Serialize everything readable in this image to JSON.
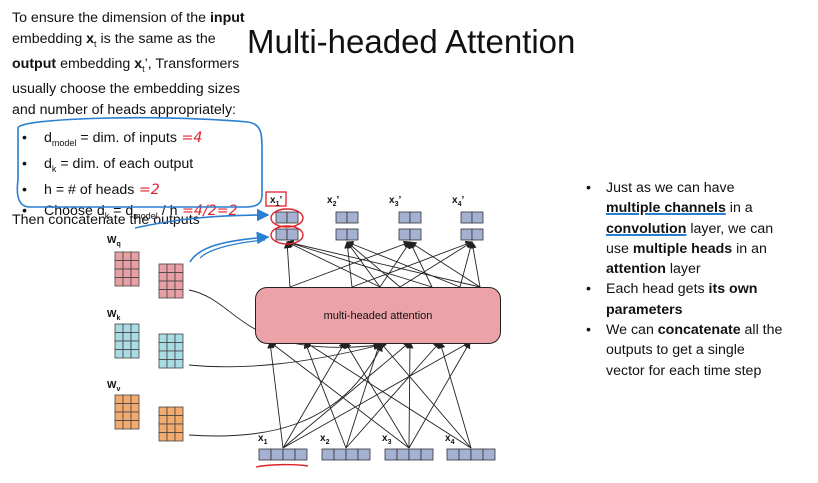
{
  "slide": {
    "title": "Multi-headed Attention",
    "intro": {
      "p1": "To ensure the dimension of the ",
      "b1": "input",
      "p2": " embedding ",
      "xt": "x",
      "xt_sub": "t",
      "p3": " is the same as the ",
      "b2": "output",
      "p4": " embedding ",
      "xtp": "x",
      "xtp_sub": "t",
      "p5": "’, Transformers usually choose the embedding sizes and number of heads appropriately:"
    },
    "bullets": [
      {
        "pre": "d",
        "sub": "model",
        "post": " = dim. of inputs",
        "note": " =4"
      },
      {
        "pre": "d",
        "sub": "k",
        "post": " = dim. of each output",
        "note": ""
      },
      {
        "pre": "h = # of heads",
        "sub": "",
        "post": "",
        "note": " =2"
      },
      {
        "pre": "Choose d",
        "sub": "k",
        "post": " = d",
        "sub2": "model",
        "post2": " / h",
        "note": " =4/2=2"
      }
    ],
    "concat": "Then concatenate the outputs",
    "right_bullets": {
      "b1": {
        "t1": "Just as we can have ",
        "k1": "multiple channels",
        "t2": " in a ",
        "k2": "convolution",
        "t3": " layer, we can use ",
        "k3": "multiple heads",
        "t4": " in an ",
        "k4": "attention",
        "t5": " layer"
      },
      "b2": {
        "t1": "Each head gets ",
        "k1": "its own parameters"
      },
      "b3": {
        "t1": "We can ",
        "k1": "concatenate",
        "t2": " all the outputs to get a single vector for each time step"
      }
    }
  },
  "diagram": {
    "box_label": "multi-headed attention",
    "weights": [
      {
        "name": "W",
        "sub": "q",
        "color": "#e9a0a4"
      },
      {
        "name": "W",
        "sub": "k",
        "color": "#a8dbe4"
      },
      {
        "name": "W",
        "sub": "v",
        "color": "#f2aa6d"
      }
    ],
    "inputs": [
      {
        "name": "x",
        "sub": "1"
      },
      {
        "name": "x",
        "sub": "2"
      },
      {
        "name": "x",
        "sub": "3"
      },
      {
        "name": "x",
        "sub": "4"
      }
    ],
    "outputs": [
      {
        "name": "x",
        "sub": "1",
        "prime": "’"
      },
      {
        "name": "x",
        "sub": "2",
        "prime": "’"
      },
      {
        "name": "x",
        "sub": "3",
        "prime": "’"
      },
      {
        "name": "x",
        "sub": "4",
        "prime": "’"
      }
    ],
    "vector_color": "#a5b1d3"
  },
  "colors": {
    "annotation_red": "#e0202a",
    "annotation_blue": "#2a7fd0"
  }
}
